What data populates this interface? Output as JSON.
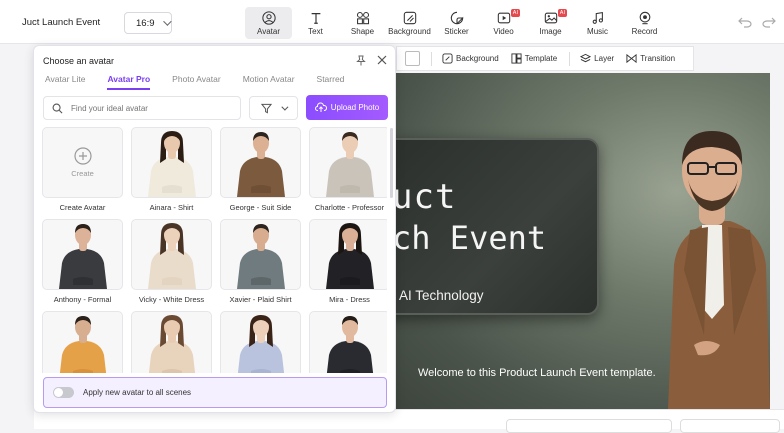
{
  "project": {
    "title": "Juct Launch Event",
    "ratio": "16:9"
  },
  "toolbar": [
    {
      "id": "avatar",
      "label": "Avatar",
      "active": true,
      "ai": false
    },
    {
      "id": "text",
      "label": "Text",
      "ai": false
    },
    {
      "id": "shape",
      "label": "Shape",
      "ai": false
    },
    {
      "id": "background",
      "label": "Background",
      "ai": false
    },
    {
      "id": "sticker",
      "label": "Sticker",
      "ai": false
    },
    {
      "id": "video",
      "label": "Video",
      "ai": true
    },
    {
      "id": "image",
      "label": "Image",
      "ai": true
    },
    {
      "id": "music",
      "label": "Music",
      "ai": false
    },
    {
      "id": "record",
      "label": "Record",
      "ai": false
    }
  ],
  "ai_badge": "AI",
  "canvas_toolbar": {
    "background": "Background",
    "template": "Template",
    "layer": "Layer",
    "transition": "Transition"
  },
  "stage": {
    "line1": "uct",
    "line2": "ch Event",
    "line3": "AI Technology",
    "welcome": "Welcome to this Product Launch Event template."
  },
  "panel": {
    "title": "Choose an avatar",
    "tabs": [
      "Avatar Lite",
      "Avatar Pro",
      "Photo Avatar",
      "Motion Avatar",
      "Starred"
    ],
    "active_tab": "Avatar Pro",
    "search_placeholder": "Find your ideal avatar",
    "upload_label": "Upload Photo",
    "create_label": "Create",
    "apply_label": "Apply new avatar to all scenes",
    "avatars": [
      {
        "name": "Create Avatar",
        "create": true
      },
      {
        "name": "Ainara - Shirt",
        "skin": "#e9c9ad",
        "hair": "#2b1d14",
        "top": "#efeadc",
        "bottom": "#e4dfd0",
        "long": true
      },
      {
        "name": "George - Suit Side",
        "skin": "#dcb092",
        "hair": "#2c241e",
        "top": "#7b5a3e",
        "bottom": "#6f4f35",
        "long": false
      },
      {
        "name": "Charlotte - Professor",
        "skin": "#ebcdb5",
        "hair": "#3a2a20",
        "top": "#c9c3ba",
        "bottom": "#bfb8ad",
        "long": false
      },
      {
        "name": "Anthony - Formal",
        "skin": "#dcb398",
        "hair": "#2d221b",
        "top": "#3a3b3f",
        "bottom": "#2f3034",
        "long": false
      },
      {
        "name": "Vicky - White Dress",
        "skin": "#ecd1bb",
        "hair": "#4a3426",
        "top": "#e9dccb",
        "bottom": "#e3d4c1",
        "long": true
      },
      {
        "name": "Xavier - Plaid Shirt",
        "skin": "#d8ad8f",
        "hair": "#2b2420",
        "top": "#6f7b7e",
        "bottom": "#5d6769",
        "long": false
      },
      {
        "name": "Mira - Dress",
        "skin": "#d9b095",
        "hair": "#1c1612",
        "top": "#222226",
        "bottom": "#1b1b1f",
        "long": true
      },
      {
        "name": "",
        "skin": "#d8ae90",
        "hair": "#2c201a",
        "top": "#e5a147",
        "bottom": "#d8913a",
        "long": false
      },
      {
        "name": "",
        "skin": "#e9cbb2",
        "hair": "#6b4a34",
        "top": "#e8d3bd",
        "bottom": "#dcc5ad",
        "long": true
      },
      {
        "name": "",
        "skin": "#ecd0ba",
        "hair": "#3a2418",
        "top": "#b9c3dd",
        "bottom": "#a9b4d2",
        "long": true
      },
      {
        "name": "",
        "skin": "#e1b99e",
        "hair": "#241c17",
        "top": "#2a2b30",
        "bottom": "#1f2024",
        "long": false
      }
    ]
  },
  "colors": {
    "accent": "#7a3ff0",
    "stage_bg": "#5d665a"
  }
}
